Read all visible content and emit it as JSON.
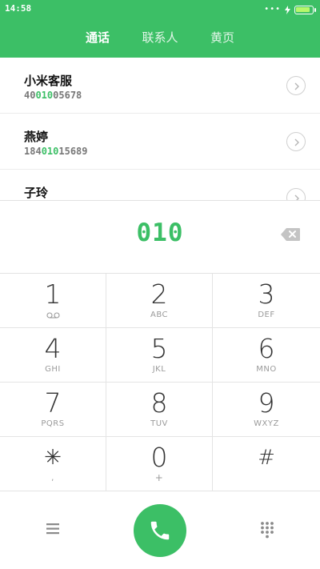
{
  "status_bar": {
    "time": "14:58",
    "dots": "•••",
    "battery_level": 0.9
  },
  "tabs": [
    {
      "label": "通话",
      "active": true
    },
    {
      "label": "联系人",
      "active": false
    },
    {
      "label": "黄页",
      "active": false
    }
  ],
  "contacts": [
    {
      "name": "小米客服",
      "phone_pre": "40",
      "phone_match": "010",
      "phone_post": "05678"
    },
    {
      "name": "燕婷",
      "phone_pre": "184",
      "phone_match": "010",
      "phone_post": "15689"
    },
    {
      "name": "子玲",
      "phone_pre": "",
      "phone_match": "",
      "phone_post": ""
    }
  ],
  "dialer": {
    "number": "010"
  },
  "keypad": [
    {
      "digit": "1",
      "letters": "",
      "sub_icon": "voicemail-icon"
    },
    {
      "digit": "2",
      "letters": "ABC"
    },
    {
      "digit": "3",
      "letters": "DEF"
    },
    {
      "digit": "4",
      "letters": "GHI"
    },
    {
      "digit": "5",
      "letters": "JKL"
    },
    {
      "digit": "6",
      "letters": "MNO"
    },
    {
      "digit": "7",
      "letters": "PQRS"
    },
    {
      "digit": "8",
      "letters": "TUV"
    },
    {
      "digit": "9",
      "letters": "WXYZ"
    },
    {
      "digit": "✳",
      "letters": ","
    },
    {
      "digit": "0",
      "letters": "+"
    },
    {
      "digit": "#",
      "letters": ""
    }
  ],
  "colors": {
    "accent": "#3cbf66",
    "battery": "#b6f76b",
    "digit": "#333333",
    "muted": "#9a9a9a"
  },
  "icons": {
    "backspace": "backspace-icon",
    "menu": "menu-icon",
    "call": "phone-icon",
    "dialpad": "dialpad-icon",
    "contact_detail": "chevron-right-icon"
  }
}
